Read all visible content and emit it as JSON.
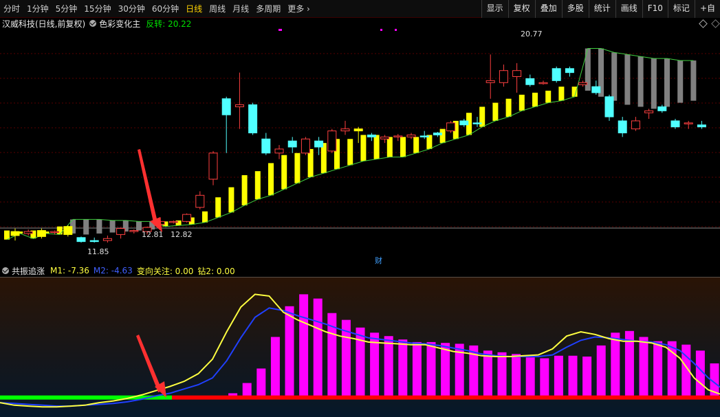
{
  "toolbar": {
    "periods": [
      "分时",
      "1分钟",
      "5分钟",
      "15分钟",
      "30分钟",
      "60分钟",
      "日线",
      "周线",
      "月线",
      "多周期",
      "更多"
    ],
    "active": "日线",
    "right_buttons": [
      "显示",
      "复权",
      "叠加",
      "多股",
      "统计",
      "画线",
      "F10",
      "标记",
      "+自"
    ]
  },
  "main_panel": {
    "stock_name": "汉威科技(日线,前复权)",
    "indicator_name": "色彩变化主",
    "indicator_label": "反转: 20.22",
    "price_labels": {
      "high": "20.77",
      "low": "11.85",
      "mark_left": "12.81",
      "mark_right": "12.82"
    },
    "cai_marker": "财"
  },
  "sub_panel": {
    "name": "共振追涨",
    "m1": "M1: -7.36",
    "m2": "M2: -4.63",
    "zx": "变向关注: 0.00",
    "z2": "钻2: 0.00"
  },
  "colors": {
    "up": "#ff4040",
    "down": "#50ffff",
    "yellow": "#ffff00",
    "gray": "#808080",
    "magenta": "#ff00ff",
    "green": "#00ff00",
    "red": "#ff0000",
    "m1": "#ffff40",
    "m2": "#2040ff"
  },
  "chart_data": {
    "type": "candlestick",
    "price_range": [
      11.0,
      22.2
    ],
    "candles": [
      {
        "o": 12.2,
        "c": 12.4,
        "h": 12.55,
        "l": 11.95,
        "color": "yellow"
      },
      {
        "o": 12.3,
        "c": 12.4,
        "h": 12.5,
        "l": 12.2,
        "color": "red"
      },
      {
        "o": 12.15,
        "c": 12.45,
        "h": 12.55,
        "l": 12.05,
        "color": "yellow"
      },
      {
        "o": 12.35,
        "c": 12.4,
        "h": 12.45,
        "l": 12.25,
        "color": "red"
      },
      {
        "o": 12.25,
        "c": 12.65,
        "h": 12.7,
        "l": 12.15,
        "color": "yellow"
      },
      {
        "o": 12.1,
        "c": 11.9,
        "h": 12.15,
        "l": 11.85,
        "color": "cyan"
      },
      {
        "o": 11.95,
        "c": 11.95,
        "h": 12.1,
        "l": 11.85,
        "color": "cyan"
      },
      {
        "o": 11.95,
        "c": 12.05,
        "h": 12.2,
        "l": 11.85,
        "color": "red"
      },
      {
        "o": 12.25,
        "c": 12.55,
        "h": 12.6,
        "l": 12.05,
        "color": "red"
      },
      {
        "o": 12.4,
        "c": 12.45,
        "h": 12.5,
        "l": 12.3,
        "color": "red"
      },
      {
        "o": 12.4,
        "c": 12.6,
        "h": 12.65,
        "l": 12.25,
        "color": "red"
      },
      {
        "o": 12.75,
        "c": 12.9,
        "h": 13.1,
        "l": 12.6,
        "color": "red"
      },
      {
        "o": 12.85,
        "c": 12.9,
        "h": 12.95,
        "l": 12.8,
        "color": "red"
      },
      {
        "o": 12.9,
        "c": 13.25,
        "h": 13.3,
        "l": 12.85,
        "color": "red"
      },
      {
        "o": 13.6,
        "c": 14.2,
        "h": 14.4,
        "l": 13.5,
        "color": "red"
      },
      {
        "o": 15.0,
        "c": 16.3,
        "h": 16.4,
        "l": 14.7,
        "color": "red"
      },
      {
        "o": 19.0,
        "c": 18.2,
        "h": 19.1,
        "l": 16.3,
        "color": "cyan"
      },
      {
        "o": 18.6,
        "c": 18.7,
        "h": 20.3,
        "l": 17.5,
        "color": "red"
      },
      {
        "o": 18.7,
        "c": 17.3,
        "h": 18.8,
        "l": 17.2,
        "color": "cyan"
      },
      {
        "o": 17.0,
        "c": 16.3,
        "h": 17.3,
        "l": 16.2,
        "color": "cyan"
      },
      {
        "o": 16.3,
        "c": 16.5,
        "h": 16.7,
        "l": 16.0,
        "color": "red"
      },
      {
        "o": 16.6,
        "c": 16.9,
        "h": 17.1,
        "l": 16.3,
        "color": "cyan"
      },
      {
        "o": 16.3,
        "c": 17.0,
        "h": 17.1,
        "l": 16.2,
        "color": "red"
      },
      {
        "o": 16.6,
        "c": 16.9,
        "h": 17.1,
        "l": 16.2,
        "color": "cyan"
      },
      {
        "o": 16.4,
        "c": 17.4,
        "h": 17.5,
        "l": 16.3,
        "color": "red"
      },
      {
        "o": 17.4,
        "c": 17.5,
        "h": 17.9,
        "l": 17.2,
        "color": "red"
      },
      {
        "o": 17.5,
        "c": 17.4,
        "h": 17.6,
        "l": 16.8,
        "color": "yellow"
      },
      {
        "o": 17.2,
        "c": 17.1,
        "h": 17.3,
        "l": 16.9,
        "color": "cyan"
      },
      {
        "o": 17.0,
        "c": 17.1,
        "h": 17.2,
        "l": 16.8,
        "color": "red"
      },
      {
        "o": 17.1,
        "c": 17.15,
        "h": 17.25,
        "l": 16.9,
        "color": "red"
      },
      {
        "o": 17.1,
        "c": 17.2,
        "h": 17.3,
        "l": 17.0,
        "color": "red"
      },
      {
        "o": 17.1,
        "c": 17.15,
        "h": 17.4,
        "l": 17.0,
        "color": "cyan"
      },
      {
        "o": 17.2,
        "c": 17.3,
        "h": 17.35,
        "l": 17.1,
        "color": "cyan"
      },
      {
        "o": 17.4,
        "c": 17.8,
        "h": 17.9,
        "l": 17.3,
        "color": "red"
      },
      {
        "o": 17.9,
        "c": 17.7,
        "h": 18.0,
        "l": 17.6,
        "color": "cyan"
      },
      {
        "o": 17.8,
        "c": 17.8,
        "h": 18.1,
        "l": 17.6,
        "color": "cyan"
      },
      {
        "o": 19.8,
        "c": 19.9,
        "h": 21.2,
        "l": 19.0,
        "color": "red"
      },
      {
        "o": 19.8,
        "c": 20.4,
        "h": 20.7,
        "l": 19.6,
        "color": "red"
      },
      {
        "o": 20.4,
        "c": 20.1,
        "h": 20.77,
        "l": 19.3,
        "color": "red"
      },
      {
        "o": 20.0,
        "c": 19.7,
        "h": 20.2,
        "l": 19.6,
        "color": "cyan"
      },
      {
        "o": 19.8,
        "c": 19.8,
        "h": 19.9,
        "l": 19.7,
        "color": "red"
      },
      {
        "o": 20.5,
        "c": 19.9,
        "h": 20.6,
        "l": 19.8,
        "color": "cyan"
      },
      {
        "o": 20.5,
        "c": 20.3,
        "h": 20.6,
        "l": 20.1,
        "color": "cyan"
      },
      {
        "o": 19.7,
        "c": 19.8,
        "h": 19.9,
        "l": 19.6,
        "color": "red"
      },
      {
        "o": 19.6,
        "c": 19.3,
        "h": 19.9,
        "l": 19.2,
        "color": "cyan"
      },
      {
        "o": 19.1,
        "c": 18.1,
        "h": 19.2,
        "l": 17.9,
        "color": "cyan"
      },
      {
        "o": 17.9,
        "c": 17.3,
        "h": 18.1,
        "l": 17.1,
        "color": "cyan"
      },
      {
        "o": 17.5,
        "c": 17.9,
        "h": 18.1,
        "l": 17.4,
        "color": "red"
      },
      {
        "o": 18.3,
        "c": 18.4,
        "h": 18.5,
        "l": 18.0,
        "color": "red"
      },
      {
        "o": 18.6,
        "c": 18.4,
        "h": 18.7,
        "l": 18.3,
        "color": "cyan"
      },
      {
        "o": 17.9,
        "c": 17.6,
        "h": 18.0,
        "l": 17.5,
        "color": "cyan"
      },
      {
        "o": 17.8,
        "c": 17.8,
        "h": 17.9,
        "l": 17.5,
        "color": "red"
      },
      {
        "o": 17.7,
        "c": 17.6,
        "h": 17.9,
        "l": 17.5,
        "color": "cyan"
      }
    ],
    "indicator_bars": [
      {
        "top": 12.45,
        "bot": 12.0,
        "c": "yellow"
      },
      {
        "top": 12.4,
        "bot": 12.3,
        "c": "yellow"
      },
      {
        "top": 12.45,
        "bot": 12.05,
        "c": "yellow"
      },
      {
        "top": 12.4,
        "bot": 12.3,
        "c": "yellow"
      },
      {
        "top": 12.65,
        "bot": 12.25,
        "c": "yellow"
      },
      {
        "top": 13.0,
        "bot": 12.3,
        "c": "gray"
      },
      {
        "top": 13.0,
        "bot": 12.25,
        "c": "gray"
      },
      {
        "top": 13.0,
        "bot": 12.3,
        "c": "gray"
      },
      {
        "top": 12.95,
        "bot": 12.35,
        "c": "gray"
      },
      {
        "top": 12.95,
        "bot": 12.4,
        "c": "gray"
      },
      {
        "top": 12.9,
        "bot": 12.45,
        "c": "gray"
      },
      {
        "top": 12.9,
        "bot": 12.5,
        "c": "gray"
      },
      {
        "top": 12.9,
        "bot": 12.65,
        "c": "yellow"
      },
      {
        "top": 12.95,
        "bot": 12.7,
        "c": "yellow"
      },
      {
        "top": 13.1,
        "bot": 12.75,
        "c": "yellow"
      },
      {
        "top": 13.4,
        "bot": 12.85,
        "c": "yellow"
      },
      {
        "top": 14.1,
        "bot": 13.1,
        "c": "yellow"
      },
      {
        "top": 14.6,
        "bot": 13.35,
        "c": "yellow"
      },
      {
        "top": 15.2,
        "bot": 13.7,
        "c": "yellow"
      },
      {
        "top": 15.4,
        "bot": 14.0,
        "c": "yellow"
      },
      {
        "top": 15.8,
        "bot": 14.2,
        "c": "yellow"
      },
      {
        "top": 16.2,
        "bot": 14.5,
        "c": "yellow"
      },
      {
        "top": 16.3,
        "bot": 14.8,
        "c": "yellow"
      },
      {
        "top": 16.5,
        "bot": 15.1,
        "c": "yellow"
      },
      {
        "top": 16.8,
        "bot": 15.3,
        "c": "yellow"
      },
      {
        "top": 17.0,
        "bot": 15.5,
        "c": "yellow"
      },
      {
        "top": 17.0,
        "bot": 15.7,
        "c": "yellow"
      },
      {
        "top": 17.2,
        "bot": 15.9,
        "c": "yellow"
      },
      {
        "top": 17.2,
        "bot": 16.0,
        "c": "yellow"
      },
      {
        "top": 17.1,
        "bot": 16.1,
        "c": "yellow"
      },
      {
        "top": 17.1,
        "bot": 16.1,
        "c": "yellow"
      },
      {
        "top": 17.1,
        "bot": 16.3,
        "c": "yellow"
      },
      {
        "top": 17.2,
        "bot": 16.5,
        "c": "yellow"
      },
      {
        "top": 17.5,
        "bot": 16.8,
        "c": "yellow"
      },
      {
        "top": 17.9,
        "bot": 17.0,
        "c": "yellow"
      },
      {
        "top": 18.3,
        "bot": 17.2,
        "c": "yellow"
      },
      {
        "top": 18.6,
        "bot": 17.6,
        "c": "yellow"
      },
      {
        "top": 18.8,
        "bot": 17.9,
        "c": "yellow"
      },
      {
        "top": 19.0,
        "bot": 18.1,
        "c": "yellow"
      },
      {
        "top": 19.2,
        "bot": 18.4,
        "c": "yellow"
      },
      {
        "top": 19.3,
        "bot": 18.6,
        "c": "yellow"
      },
      {
        "top": 19.4,
        "bot": 18.8,
        "c": "yellow"
      },
      {
        "top": 19.6,
        "bot": 18.9,
        "c": "yellow"
      },
      {
        "top": 19.6,
        "bot": 19.1,
        "c": "yellow"
      },
      {
        "top": 21.5,
        "bot": 19.4,
        "c": "gray"
      },
      {
        "top": 21.5,
        "bot": 19.1,
        "c": "gray"
      },
      {
        "top": 21.3,
        "bot": 18.9,
        "c": "gray"
      },
      {
        "top": 21.2,
        "bot": 18.7,
        "c": "gray"
      },
      {
        "top": 21.1,
        "bot": 18.6,
        "c": "gray"
      },
      {
        "top": 21.0,
        "bot": 18.5,
        "c": "gray"
      },
      {
        "top": 21.0,
        "bot": 18.6,
        "c": "gray"
      },
      {
        "top": 20.9,
        "bot": 18.8,
        "c": "gray"
      },
      {
        "top": 20.9,
        "bot": 18.9,
        "c": "gray"
      }
    ],
    "sub_bars": [
      0,
      0,
      0,
      0,
      0,
      0,
      0,
      0,
      0,
      0,
      0,
      0,
      0,
      0,
      0,
      0.2,
      0.5,
      1.7,
      3.4,
      7.1,
      10.7,
      12.1,
      11.6,
      9.9,
      9.1,
      8.2,
      7.6,
      7.2,
      6.8,
      6.5,
      6.5,
      6.4,
      6.3,
      6.1,
      5.5,
      5.3,
      5.1,
      4.7,
      4.6,
      4.9,
      4.9,
      4.8,
      6.1,
      7.6,
      7.8,
      7.1,
      6.6,
      6.6,
      6.2,
      5.5,
      4.0,
      1.4,
      0.3,
      0.3,
      0.1,
      0
    ],
    "sub_m1": [
      -0.6,
      -0.9,
      -1.0,
      -1.1,
      -1.1,
      -1.0,
      -0.9,
      -0.6,
      -0.4,
      -0.1,
      0.3,
      0.8,
      1.3,
      1.9,
      2.8,
      4.5,
      7.7,
      10.6,
      12.1,
      11.9,
      10.0,
      9.1,
      8.4,
      7.7,
      7.2,
      6.9,
      6.5,
      6.4,
      6.3,
      6.2,
      6.2,
      5.8,
      5.4,
      5.2,
      4.9,
      4.8,
      4.8,
      4.9,
      5.0,
      5.7,
      7.2,
      7.7,
      7.4,
      6.9,
      6.6,
      6.6,
      6.4,
      5.9,
      4.6,
      2.3,
      0.9,
      0.3,
      0.1,
      -0.2,
      -0.8,
      -1.6
    ],
    "sub_m2": [
      -0.6,
      -0.7,
      -0.8,
      -0.9,
      -1.0,
      -1.0,
      -0.9,
      -0.8,
      -0.7,
      -0.5,
      -0.2,
      0.2,
      0.5,
      1.0,
      1.5,
      2.3,
      4.3,
      7.0,
      9.4,
      10.5,
      10.2,
      9.6,
      9.1,
      8.6,
      8.0,
      7.5,
      7.0,
      6.8,
      6.6,
      6.4,
      6.3,
      6.1,
      5.8,
      5.5,
      5.1,
      4.9,
      4.8,
      4.8,
      4.8,
      5.0,
      5.9,
      6.7,
      7.1,
      7.0,
      6.8,
      6.6,
      6.5,
      6.2,
      5.5,
      4.0,
      2.3,
      1.0,
      0.5,
      0.1,
      -0.4,
      -1.0
    ],
    "sub_range": [
      -1.8,
      13.5
    ],
    "base_split": 11
  }
}
